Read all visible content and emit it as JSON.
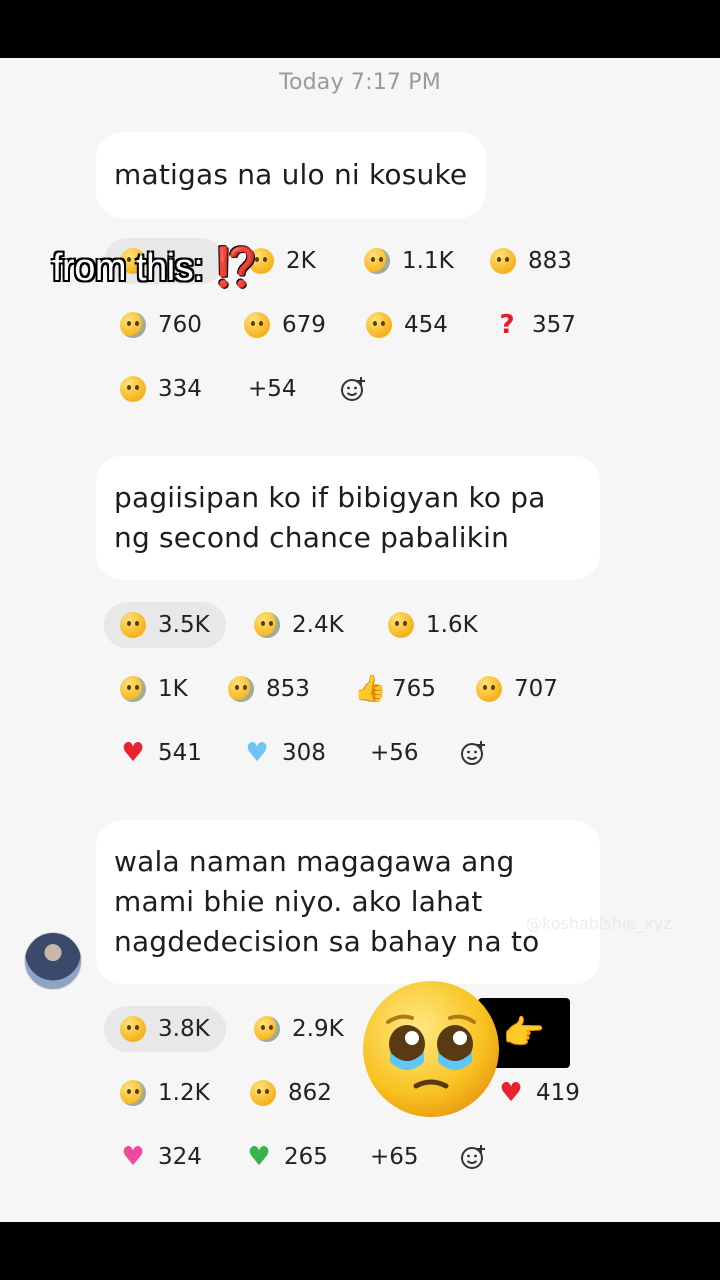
{
  "timestamp": "Today 7:17 PM",
  "overlay": {
    "text": "from this:",
    "mark": "⁉️"
  },
  "watermark": "@koshablshie_xyz",
  "messages": [
    {
      "lines": [
        "matigas na ulo ni kosuke"
      ],
      "reaction_rows": [
        [
          {
            "emoji": "sad-face-icon",
            "count": "2K"
          },
          {
            "emoji": "pleading-face-icon",
            "count": "1.1K"
          },
          {
            "emoji": "pensive-face-icon",
            "count": "883"
          }
        ],
        [
          {
            "emoji": "downcast-sweat-face-icon",
            "count": "760"
          },
          {
            "emoji": "screaming-face-icon",
            "count": "679"
          },
          {
            "emoji": "slight-smile-icon",
            "count": "454"
          },
          {
            "emoji": "question-mark-icon",
            "count": "357"
          }
        ],
        [
          {
            "emoji": "laughing-face-icon",
            "count": "334"
          },
          {
            "emoji": "more",
            "count": "+54"
          }
        ]
      ]
    },
    {
      "lines": [
        "pagiisipan ko if bibigyan ko pa",
        "ng second chance pabalikin"
      ],
      "reaction_rows": [
        [
          {
            "emoji": "confused-face-icon",
            "count": "3.5K"
          },
          {
            "emoji": "crying-face-icon",
            "count": "2.4K"
          },
          {
            "emoji": "frowning-face-icon",
            "count": "1.6K"
          }
        ],
        [
          {
            "emoji": "pleading-face-icon",
            "count": "1K"
          },
          {
            "emoji": "downcast-sweat-face-icon",
            "count": "853"
          },
          {
            "emoji": "thumbs-up-icon",
            "count": "765"
          },
          {
            "emoji": "confused-face-icon",
            "count": "707"
          }
        ],
        [
          {
            "emoji": "red-heart-icon",
            "count": "541"
          },
          {
            "emoji": "blue-heart-icon",
            "count": "308"
          },
          {
            "emoji": "more",
            "count": "+56"
          }
        ]
      ]
    },
    {
      "lines": [
        "wala naman magagawa ang",
        "mami bhie niyo. ako lahat",
        "nagdedecision sa bahay na to"
      ],
      "reaction_rows": [
        [
          {
            "emoji": "confused-face-icon",
            "count": "3.8K"
          },
          {
            "emoji": "crying-face-icon",
            "count": "2.9K"
          }
        ],
        [
          {
            "emoji": "downcast-sweat-face-icon",
            "count": "1.2K"
          },
          {
            "emoji": "pensive-face-icon",
            "count": "862"
          },
          {
            "emoji": "red-heart-icon",
            "count": "419"
          }
        ],
        [
          {
            "emoji": "pink-heart-icon",
            "count": "324"
          },
          {
            "emoji": "green-heart-icon",
            "count": "265"
          },
          {
            "emoji": "more",
            "count": "+65"
          }
        ]
      ]
    }
  ]
}
